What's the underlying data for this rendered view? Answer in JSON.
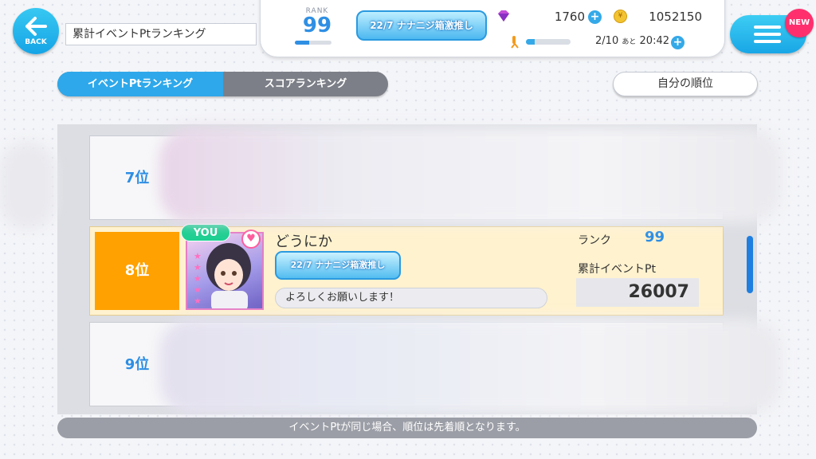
{
  "header": {
    "back_label": "BACK",
    "title": "累計イベントPtランキング",
    "rank_label": "RANK",
    "rank_value": "99",
    "rank_progress": 0.4,
    "title_badge": "22/7 ナナニジ箱激推し",
    "gems": "1760",
    "coins": "1052150",
    "stamina_progress": 0.2,
    "stamina_text": "2/10",
    "stamina_suffix": "あと",
    "stamina_timer": "20:42",
    "new_badge": "NEW"
  },
  "tabs": [
    {
      "label": "イベントPtランキング",
      "active": true
    },
    {
      "label": "スコアランキング",
      "active": false
    }
  ],
  "my_rank_button": "自分の順位",
  "rows": [
    {
      "rank": "7位"
    },
    {
      "rank": "8位",
      "you_label": "YOU",
      "name": "どうにか",
      "badge": "22/7 ナナニジ箱激推し",
      "comment": "よろしくお願いします！",
      "rank_label": "ランク",
      "player_rank": "99",
      "pt_label": "累計イベントPt",
      "pt_value": "26007"
    },
    {
      "rank": "9位"
    }
  ],
  "footer_note": "イベントPtが同じ場合、順位は先着順となります。",
  "colors": {
    "accent_blue": "#2ea8ea",
    "highlight_orange": "#ffa100",
    "you_green": "#1fcf92",
    "new_pink": "#ff2f6e"
  }
}
